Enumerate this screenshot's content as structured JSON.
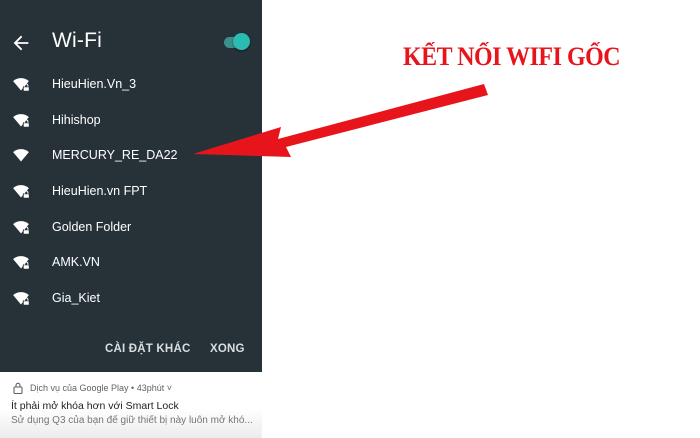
{
  "wifi": {
    "title": "Wi-Fi",
    "enabled": true,
    "networks": [
      {
        "name": "HieuHien.Vn_3",
        "icon": "wifi-lock-icon"
      },
      {
        "name": "Hihishop",
        "icon": "wifi-lock-icon"
      },
      {
        "name": "MERCURY_RE_DA22",
        "icon": "wifi-icon"
      },
      {
        "name": "HieuHien.vn FPT",
        "icon": "wifi-lock-icon"
      },
      {
        "name": "Golden Folder",
        "icon": "wifi-lock-icon"
      },
      {
        "name": "AMK.VN",
        "icon": "wifi-lock-icon"
      },
      {
        "name": "Gia_Kiet",
        "icon": "wifi-lock-icon"
      }
    ],
    "more_settings_label": "CÀI ĐẶT KHÁC",
    "done_label": "XONG"
  },
  "notification": {
    "source": "Dịch vụ của Google Play • 43phút ˅",
    "title": "Ít phải mở khóa hơn với Smart Lock",
    "body": "Sử dụng Q3 của bạn để giữ thiết bị này luôn mở khó..."
  },
  "annotation": {
    "text": "KẾT NỐI WIFI GỐC",
    "color": "#e8141b"
  },
  "colors": {
    "panel_bg": "#263238",
    "toggle_accent": "#2bbcb1"
  }
}
